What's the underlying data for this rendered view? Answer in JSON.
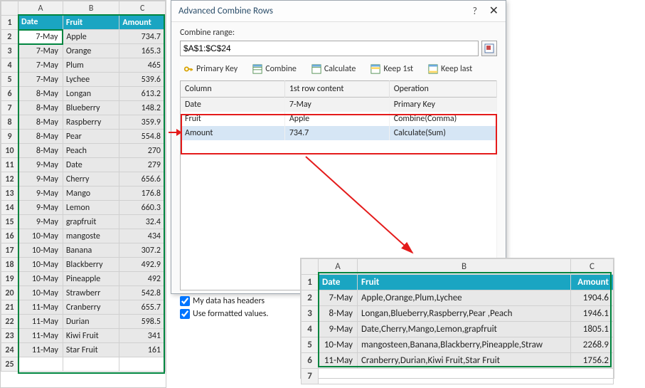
{
  "sheet_left": {
    "col_headers": [
      "",
      "A",
      "B",
      "C"
    ],
    "headers": [
      "Date",
      "Fruit",
      "Amount"
    ],
    "rows": [
      {
        "n": "2",
        "a": "7-May",
        "b": "Apple",
        "c": "734.7"
      },
      {
        "n": "3",
        "a": "7-May",
        "b": "Orange",
        "c": "165.3"
      },
      {
        "n": "4",
        "a": "7-May",
        "b": "Plum",
        "c": "465"
      },
      {
        "n": "5",
        "a": "7-May",
        "b": "Lychee",
        "c": "539.6"
      },
      {
        "n": "6",
        "a": "8-May",
        "b": "Longan",
        "c": "613.2"
      },
      {
        "n": "7",
        "a": "8-May",
        "b": "Blueberry",
        "c": "148.2"
      },
      {
        "n": "8",
        "a": "8-May",
        "b": "Raspberry",
        "c": "359.9"
      },
      {
        "n": "9",
        "a": "8-May",
        "b": "Pear",
        "c": "554.8"
      },
      {
        "n": "10",
        "a": "8-May",
        "b": "Peach",
        "c": "270"
      },
      {
        "n": "11",
        "a": "9-May",
        "b": "Date",
        "c": "279"
      },
      {
        "n": "12",
        "a": "9-May",
        "b": "Cherry",
        "c": "656.6"
      },
      {
        "n": "13",
        "a": "9-May",
        "b": "Mango",
        "c": "176.8"
      },
      {
        "n": "14",
        "a": "9-May",
        "b": "Lemon",
        "c": "660.3"
      },
      {
        "n": "15",
        "a": "9-May",
        "b": "grapfruit",
        "c": "32.4"
      },
      {
        "n": "16",
        "a": "10-May",
        "b": "mangoste",
        "c": "434"
      },
      {
        "n": "17",
        "a": "10-May",
        "b": "Banana",
        "c": "307.2"
      },
      {
        "n": "18",
        "a": "10-May",
        "b": "Blackberry",
        "c": "492.9"
      },
      {
        "n": "19",
        "a": "10-May",
        "b": "Pineapple",
        "c": "492"
      },
      {
        "n": "20",
        "a": "10-May",
        "b": "Strawberr",
        "c": "542.8"
      },
      {
        "n": "21",
        "a": "11-May",
        "b": "Cranberry",
        "c": "655.7"
      },
      {
        "n": "22",
        "a": "11-May",
        "b": "Durian",
        "c": "598.5"
      },
      {
        "n": "23",
        "a": "11-May",
        "b": "Kiwi Fruit",
        "c": "341"
      },
      {
        "n": "24",
        "a": "11-May",
        "b": "Star Fruit",
        "c": "161"
      }
    ],
    "last_row": "25"
  },
  "dialog": {
    "title": "Advanced Combine Rows",
    "help": "?",
    "close": "✕",
    "range_label": "Combine range:",
    "range_value": "$A$1:$C$24",
    "toolbar": {
      "primary": "Primary Key",
      "combine": "Combine",
      "calculate": "Calculate",
      "keep1st": "Keep 1st",
      "keeplast": "Keep last"
    },
    "cols": {
      "hdr_col": "Column",
      "hdr_first": "1st row content",
      "hdr_op": "Operation",
      "rows": [
        {
          "col": "Date",
          "first": "7-May",
          "op": "Primary Key"
        },
        {
          "col": "Fruit",
          "first": "Apple",
          "op": "Combine(Comma)"
        },
        {
          "col": "Amount",
          "first": "734.7",
          "op": "Calculate(Sum)"
        }
      ]
    },
    "check1": "My data has headers",
    "check2": "Use formatted values."
  },
  "sheet_right": {
    "col_headers": [
      "",
      "A",
      "B",
      "C"
    ],
    "headers": [
      "Date",
      "Fruit",
      "Amount"
    ],
    "rows": [
      {
        "n": "2",
        "a": "7-May",
        "b": "Apple,Orange,Plum,Lychee",
        "c": "1904.6"
      },
      {
        "n": "3",
        "a": "8-May",
        "b": "Longan,Blueberry,Raspberry,Pear ,Peach",
        "c": "1946.1"
      },
      {
        "n": "4",
        "a": "9-May",
        "b": "Date,Cherry,Mango,Lemon,grapfruit",
        "c": "1805.1"
      },
      {
        "n": "5",
        "a": "10-May",
        "b": "mangosteen,Banana,Blackberry,Pineapple,Straw",
        "c": "2268.9"
      },
      {
        "n": "6",
        "a": "11-May",
        "b": "Cranberry,Durian,Kiwi Fruit,Star Fruit",
        "c": "1756.2"
      }
    ],
    "last_row": "7"
  }
}
